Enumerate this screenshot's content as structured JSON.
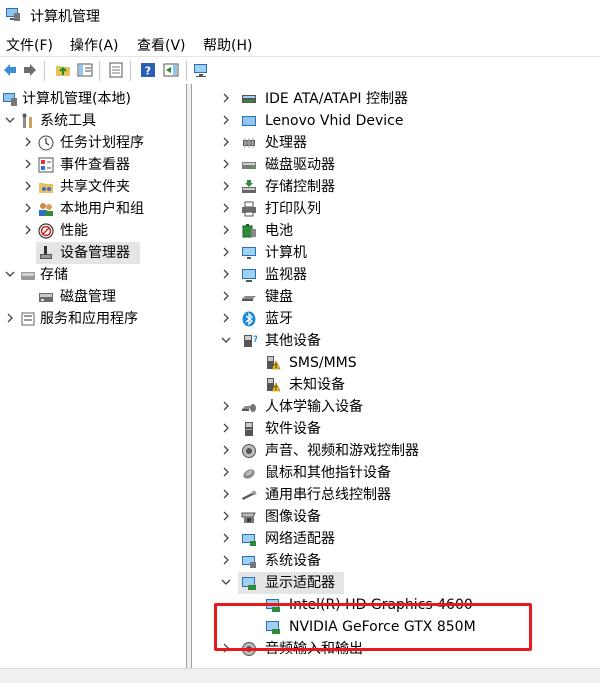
{
  "window": {
    "title": "计算机管理"
  },
  "menu": {
    "file": "文件(F)",
    "action": "操作(A)",
    "view": "查看(V)",
    "help": "帮助(H)"
  },
  "tree": {
    "root": "计算机管理(本地)",
    "system_tools": "系统工具",
    "task_scheduler": "任务计划程序",
    "event_viewer": "事件查看器",
    "shared_folders": "共享文件夹",
    "local_users": "本地用户和组",
    "performance": "性能",
    "device_manager": "设备管理器",
    "storage": "存储",
    "disk_management": "磁盘管理",
    "services_apps": "服务和应用程序"
  },
  "devices": [
    "IDE ATA/ATAPI 控制器",
    "Lenovo Vhid Device",
    "处理器",
    "磁盘驱动器",
    "存储控制器",
    "打印队列",
    "电池",
    "计算机",
    "监视器",
    "键盘",
    "蓝牙",
    "其他设备",
    "SMS/MMS",
    "未知设备",
    "人体学输入设备",
    "软件设备",
    "声音、视频和游戏控制器",
    "鼠标和其他指针设备",
    "通用串行总线控制器",
    "图像设备",
    "网络适配器",
    "系统设备",
    "显示适配器",
    "Intel(R) HD Graphics 4600",
    "NVIDIA GeForce GTX 850M",
    "音频输入和输出"
  ],
  "colors": {
    "highlight": "#e8191b",
    "accent": "#1e88d8"
  }
}
